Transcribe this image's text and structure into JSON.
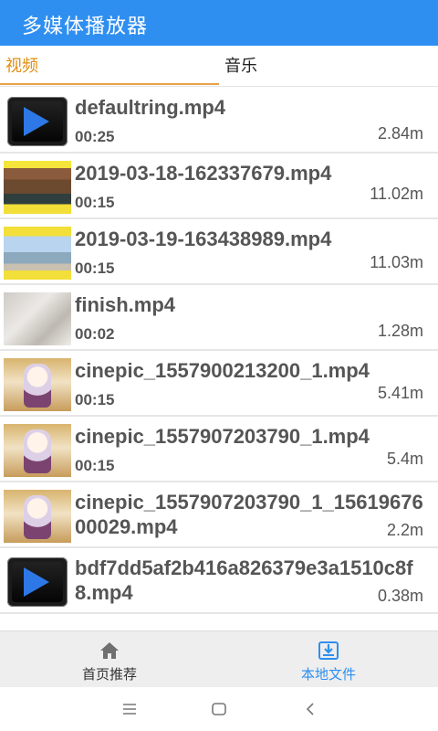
{
  "app": {
    "title": "多媒体播放器"
  },
  "tabs": [
    {
      "label": "视频",
      "active": true
    },
    {
      "label": "音乐",
      "active": false
    }
  ],
  "colors": {
    "appbar": "#2f8ff0",
    "active_tab": "#e08e12",
    "nav_active": "#2f8ff0"
  },
  "files": [
    {
      "name": "defaultring.mp4",
      "duration": "00:25",
      "size": "2.84m",
      "thumb": "play-icon"
    },
    {
      "name": "2019-03-18-162337679.mp4",
      "duration": "00:15",
      "size": "11.02m",
      "thumb": "ruins-thumbnail"
    },
    {
      "name": "2019-03-19-163438989.mp4",
      "duration": "00:15",
      "size": "11.03m",
      "thumb": "construction-crane-thumbnail"
    },
    {
      "name": "finish.mp4",
      "duration": "00:02",
      "size": "1.28m",
      "thumb": "wall-texture-thumbnail"
    },
    {
      "name": "cinepic_1557900213200_1.mp4",
      "duration": "00:15",
      "size": "5.41m",
      "thumb": "anime-girl-thumbnail"
    },
    {
      "name": "cinepic_1557907203790_1.mp4",
      "duration": "00:15",
      "size": "5.4m",
      "thumb": "anime-girl-thumbnail"
    },
    {
      "name": "cinepic_1557907203790_1_1561967600029.mp4",
      "duration": "",
      "size": "2.2m",
      "thumb": "anime-girl-thumbnail"
    },
    {
      "name": "bdf7dd5af2b416a826379e3a1510c8f8.mp4",
      "duration": "",
      "size": "0.38m",
      "thumb": "play-icon"
    }
  ],
  "bottom_nav": [
    {
      "label": "首页推荐",
      "icon": "home-icon",
      "active": false
    },
    {
      "label": "本地文件",
      "icon": "download-icon",
      "active": true
    }
  ],
  "system_nav": [
    {
      "icon": "menu-icon"
    },
    {
      "icon": "home-square-icon"
    },
    {
      "icon": "back-icon"
    }
  ]
}
